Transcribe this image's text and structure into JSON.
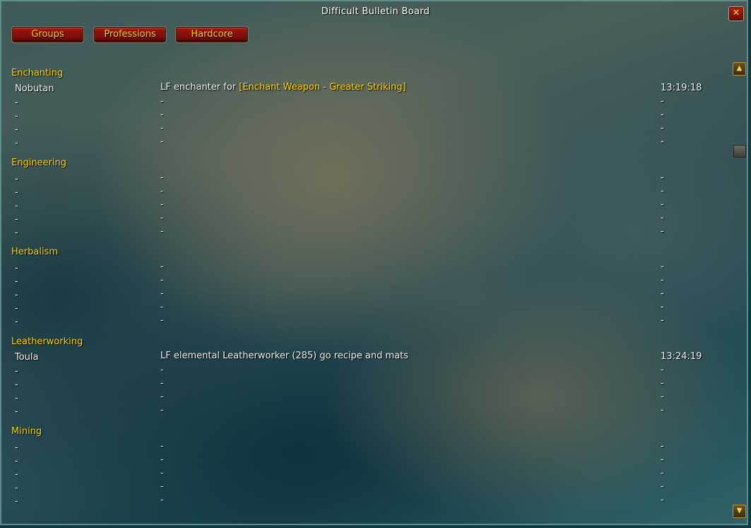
{
  "window": {
    "title": "Difficult Bulletin Board"
  },
  "tabs": [
    {
      "label": "Groups"
    },
    {
      "label": "Professions"
    },
    {
      "label": "Hardcore"
    }
  ],
  "sections": [
    {
      "title": "Enchanting",
      "rows": [
        {
          "name": "Nobutan",
          "message_prefix": "LF enchanter for ",
          "message_link": "[Enchant Weapon - Greater Striking]",
          "time": "13:19:18"
        },
        {
          "name": "-",
          "message_prefix": "-",
          "message_link": "",
          "time": "-"
        },
        {
          "name": "-",
          "message_prefix": "-",
          "message_link": "",
          "time": "-"
        },
        {
          "name": "-",
          "message_prefix": "-",
          "message_link": "",
          "time": "-"
        },
        {
          "name": "-",
          "message_prefix": "-",
          "message_link": "",
          "time": "-"
        }
      ]
    },
    {
      "title": "Engineering",
      "rows": [
        {
          "name": "-",
          "message_prefix": "-",
          "message_link": "",
          "time": "-"
        },
        {
          "name": "-",
          "message_prefix": "-",
          "message_link": "",
          "time": "-"
        },
        {
          "name": "-",
          "message_prefix": "-",
          "message_link": "",
          "time": "-"
        },
        {
          "name": "-",
          "message_prefix": "-",
          "message_link": "",
          "time": "-"
        },
        {
          "name": "-",
          "message_prefix": "-",
          "message_link": "",
          "time": "-"
        }
      ]
    },
    {
      "title": "Herbalism",
      "rows": [
        {
          "name": "-",
          "message_prefix": "-",
          "message_link": "",
          "time": "-"
        },
        {
          "name": "-",
          "message_prefix": "-",
          "message_link": "",
          "time": "-"
        },
        {
          "name": "-",
          "message_prefix": "-",
          "message_link": "",
          "time": "-"
        },
        {
          "name": "-",
          "message_prefix": "-",
          "message_link": "",
          "time": "-"
        },
        {
          "name": "-",
          "message_prefix": "-",
          "message_link": "",
          "time": "-"
        }
      ]
    },
    {
      "title": "Leatherworking",
      "rows": [
        {
          "name": "Toula",
          "message_prefix": "LF elemental Leatherworker (285) go recipe and mats",
          "message_link": "",
          "time": "13:24:19"
        },
        {
          "name": "-",
          "message_prefix": "-",
          "message_link": "",
          "time": "-"
        },
        {
          "name": "-",
          "message_prefix": "-",
          "message_link": "",
          "time": "-"
        },
        {
          "name": "-",
          "message_prefix": "-",
          "message_link": "",
          "time": "-"
        },
        {
          "name": "-",
          "message_prefix": "-",
          "message_link": "",
          "time": "-"
        }
      ]
    },
    {
      "title": "Mining",
      "rows": [
        {
          "name": "-",
          "message_prefix": "-",
          "message_link": "",
          "time": "-"
        },
        {
          "name": "-",
          "message_prefix": "-",
          "message_link": "",
          "time": "-"
        },
        {
          "name": "-",
          "message_prefix": "-",
          "message_link": "",
          "time": "-"
        },
        {
          "name": "-",
          "message_prefix": "-",
          "message_link": "",
          "time": "-"
        },
        {
          "name": "-",
          "message_prefix": "-",
          "message_link": "",
          "time": "-"
        }
      ]
    }
  ],
  "icons": {
    "close": "close-icon",
    "scroll_up": "scroll-up-icon",
    "scroll_down": "scroll-down-icon"
  },
  "colors": {
    "header_gold": "#ffd100",
    "text_white": "#f0f0f0",
    "button_red": "#a21510"
  }
}
